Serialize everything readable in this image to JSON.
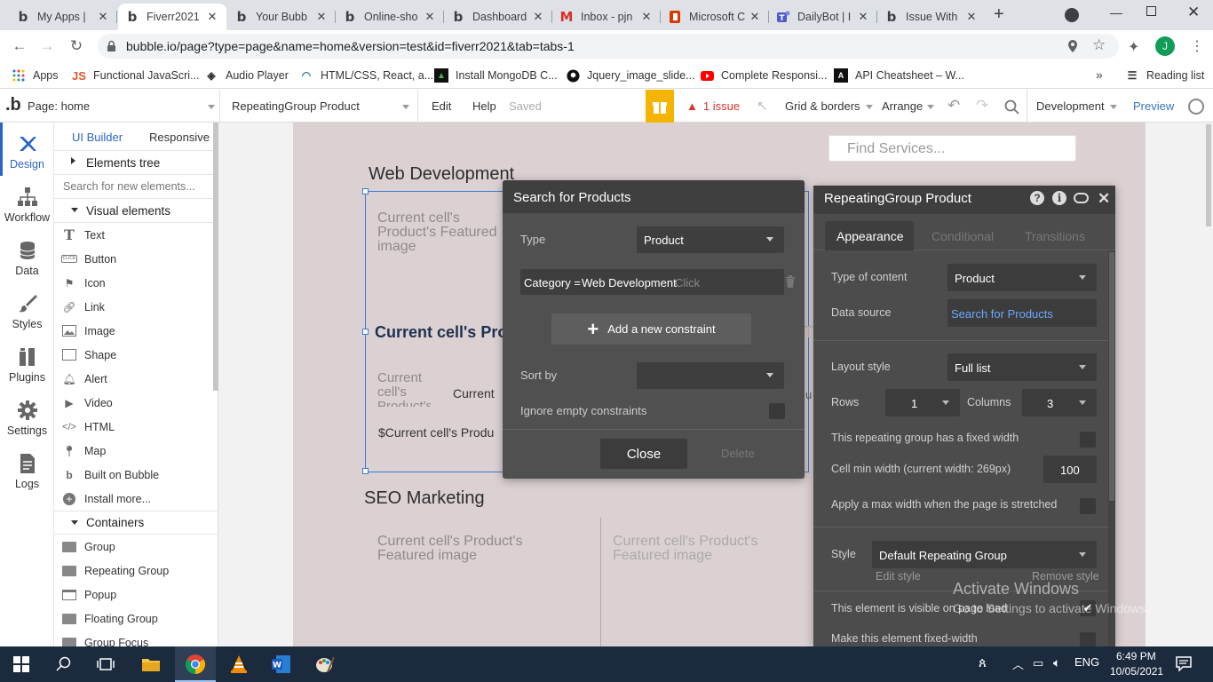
{
  "browser": {
    "tabs": [
      {
        "title": "My Apps |",
        "favicon": "bubble-icon"
      },
      {
        "title": "Fiverr2021",
        "favicon": "bubble-icon",
        "active": true
      },
      {
        "title": "Your Bubb",
        "favicon": "bubble-icon"
      },
      {
        "title": "Online-sho",
        "favicon": "bubble-icon"
      },
      {
        "title": "Dashboard",
        "favicon": "bubble-icon"
      },
      {
        "title": "Inbox - pjn",
        "favicon": "gmail-icon"
      },
      {
        "title": "Microsoft C",
        "favicon": "office-icon"
      },
      {
        "title": "DailyBot | I",
        "favicon": "teams-icon"
      },
      {
        "title": "Issue With",
        "favicon": "bubble-icon"
      }
    ],
    "url": "bubble.io/page?type=page&name=home&version=test&id=fiverr2021&tab=tabs-1",
    "profile_initial": "J",
    "bookmarks": [
      "Apps",
      "Functional JavaScri...",
      "Audio Player",
      "HTML/CSS, React, a...",
      "Install MongoDB C...",
      "Jquery_image_slide...",
      "Complete Responsi...",
      "API Cheatsheet – W..."
    ],
    "reading_list": "Reading list"
  },
  "bubble": {
    "page_selector": "Page: home",
    "element_selector": "RepeatingGroup Product",
    "menu": [
      "Edit",
      "Help"
    ],
    "saved": "Saved",
    "issues": "1 issue",
    "grid": "Grid & borders",
    "arrange": "Arrange",
    "environment": "Development",
    "preview": "Preview"
  },
  "sidebar": [
    {
      "label": "Design",
      "icon": "design-icon"
    },
    {
      "label": "Workflow",
      "icon": "workflow-icon"
    },
    {
      "label": "Data",
      "icon": "database-icon"
    },
    {
      "label": "Styles",
      "icon": "brush-icon"
    },
    {
      "label": "Plugins",
      "icon": "plugin-icon"
    },
    {
      "label": "Settings",
      "icon": "gear-icon"
    },
    {
      "label": "Logs",
      "icon": "document-icon"
    }
  ],
  "left_panel": {
    "tabs": [
      "UI Builder",
      "Responsive"
    ],
    "elements_tree": "Elements tree",
    "search_placeholder": "Search for new elements...",
    "visual_elements": "Visual elements",
    "visual_items": [
      {
        "label": "Text",
        "icon": "text-icon"
      },
      {
        "label": "Button",
        "icon": "button-icon"
      },
      {
        "label": "Icon",
        "icon": "flag-icon"
      },
      {
        "label": "Link",
        "icon": "link-icon"
      },
      {
        "label": "Image",
        "icon": "image-icon"
      },
      {
        "label": "Shape",
        "icon": "shape-icon"
      },
      {
        "label": "Alert",
        "icon": "bell-icon"
      },
      {
        "label": "Video",
        "icon": "video-icon"
      },
      {
        "label": "HTML",
        "icon": "code-icon"
      },
      {
        "label": "Map",
        "icon": "map-pin-icon"
      },
      {
        "label": "Built on Bubble",
        "icon": "bubble-icon"
      },
      {
        "label": "Install more...",
        "icon": "plus-circle-icon"
      }
    ],
    "containers": "Containers",
    "container_items": [
      {
        "label": "Group",
        "icon": "folder-icon"
      },
      {
        "label": "Repeating Group",
        "icon": "folder-icon"
      },
      {
        "label": "Popup",
        "icon": "popup-icon"
      },
      {
        "label": "Floating Group",
        "icon": "folder-icon"
      },
      {
        "label": "Group Focus",
        "icon": "folder-icon"
      }
    ]
  },
  "canvas": {
    "search_placeholder": "Find Services...",
    "section1_title": "Web Development",
    "cell_image_1": "Current cell's Product's Featured image",
    "cell_title": "Current cell's Pro",
    "cell_small_1": "Current cell's Product's",
    "cell_small_2": "Current",
    "cell_price": "$Current cell's Produ",
    "fragment_ti": "Ti",
    "fragment_u": "u",
    "section2_title": "SEO Marketing",
    "cell_image_2": "Current cell's Product's Featured image",
    "cell_image_3": "Current cell's Product's Featured image"
  },
  "search_dialog": {
    "title": "Search for Products",
    "type_label": "Type",
    "type_value": "Product",
    "constraint_key": "Category =",
    "constraint_value": "Web Development",
    "constraint_click": "Click",
    "add_constraint": "Add a new constraint",
    "sort_label": "Sort by",
    "ignore_label": "Ignore empty constraints",
    "close": "Close",
    "delete": "Delete"
  },
  "property_panel": {
    "title": "RepeatingGroup Product",
    "tabs": [
      "Appearance",
      "Conditional",
      "Transitions"
    ],
    "type_of_content_label": "Type of content",
    "type_of_content": "Product",
    "data_source_label": "Data source",
    "data_source": "Search for Products",
    "layout_style_label": "Layout style",
    "layout_style": "Full list",
    "rows_label": "Rows",
    "rows": "1",
    "columns_label": "Columns",
    "columns": "3",
    "fixed_width_label": "This repeating group has a fixed width",
    "cell_min_width_label": "Cell min width (current width: 269px)",
    "cell_min_width": "100",
    "max_width_label": "Apply a max width when the page is stretched",
    "style_label": "Style",
    "style_value": "Default Repeating Group",
    "edit_style": "Edit style",
    "remove_style": "Remove style",
    "visible_label": "This element is visible on page load",
    "fixed_width_element_label": "Make this element fixed-width"
  },
  "watermark": {
    "line1": "Activate Windows",
    "line2": "Go to Settings to activate Windows."
  },
  "taskbar": {
    "language": "ENG",
    "time": "6:49 PM",
    "date": "10/05/2021"
  }
}
